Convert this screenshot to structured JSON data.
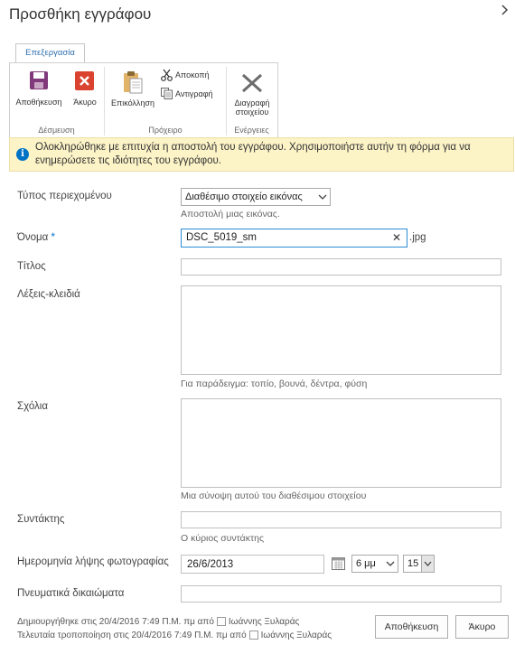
{
  "dialog": {
    "title": "Προσθήκη εγγράφου"
  },
  "ribbon": {
    "tab": "Επεξεργασία",
    "save": "Αποθήκευση",
    "cancel": "Άκυρο",
    "paste": "Επικόλληση",
    "cut": "Αποκοπή",
    "copy": "Αντιγραφή",
    "delete_line1": "Διαγραφή",
    "delete_line2": "στοιχείου",
    "group_commit": "Δέσμευση",
    "group_clipboard": "Πρόχειρο",
    "group_actions": "Ενέργειες"
  },
  "banner": {
    "text": "Ολοκληρώθηκε με επιτυχία η αποστολή του εγγράφου. Χρησιμοποιήστε αυτήν τη φόρμα για να ενημερώσετε τις ιδιότητες του εγγράφου."
  },
  "form": {
    "content_type": {
      "label": "Τύπος περιεχομένου",
      "value": "Διαθέσιμο στοιχείο εικόνας",
      "hint": "Αποστολή μιας εικόνας."
    },
    "name": {
      "label": "Όνομα",
      "required_mark": "*",
      "value": "DSC_5019_sm",
      "extension": ".jpg",
      "clear": "✕"
    },
    "title": {
      "label": "Τίτλος",
      "value": ""
    },
    "keywords": {
      "label": "Λέξεις-κλειδιά",
      "hint": "Για παράδειγμα: τοπίο, βουνά, δέντρα, φύση"
    },
    "comments": {
      "label": "Σχόλια",
      "hint": "Μια σύνοψη αυτού του διαθέσιμου στοιχείου"
    },
    "author": {
      "label": "Συντάκτης",
      "hint": "Ο κύριος συντάκτης"
    },
    "date_taken": {
      "label": "Ημερομηνία λήψης φωτογραφίας",
      "date": "26/6/2013",
      "hour": "6 μμ",
      "minute": "15"
    },
    "copyright": {
      "label": "Πνευματικά δικαιώματα"
    }
  },
  "footer": {
    "created_prefix": "Δημιουργήθηκε στις 20/4/2016 7:49 Π.Μ. πμ  από",
    "created_by": "Ιωάννης Ξυλαράς",
    "modified_prefix": "Τελευταία τροποποίηση στις 20/4/2016 7:49 Π.Μ. πμ  από",
    "modified_by": "Ιωάννης Ξυλαράς"
  },
  "buttons": {
    "save": "Αποθήκευση",
    "cancel": "Άκυρο"
  },
  "colors": {
    "accent": "#0072c6",
    "banner_bg": "#fcf3c7",
    "save_icon": "#80397b",
    "cancel_icon": "#d9432f"
  }
}
